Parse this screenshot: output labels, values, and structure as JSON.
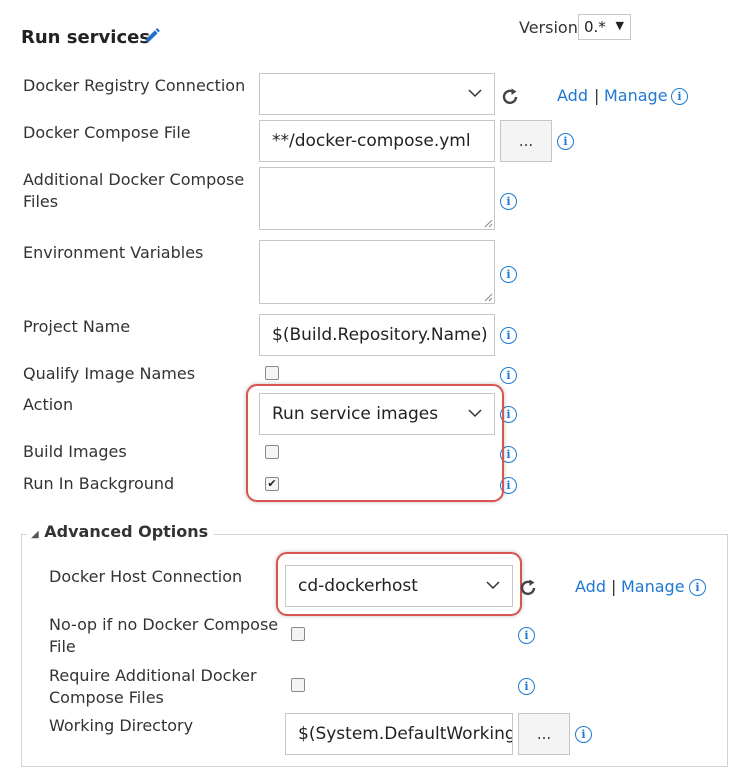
{
  "header": {
    "title": "Run services",
    "version_label": "Version",
    "version_value": "0.*"
  },
  "fields": {
    "registry": {
      "label": "Docker Registry Connection",
      "value": "",
      "add": "Add",
      "separator": "|",
      "manage": "Manage"
    },
    "compose_file": {
      "label": "Docker Compose File",
      "value": "**/docker-compose.yml",
      "browse": "..."
    },
    "additional_files": {
      "label_line1": "Additional Docker Compose",
      "label_line2": "Files",
      "value": ""
    },
    "env_vars": {
      "label": "Environment Variables",
      "value": ""
    },
    "project_name": {
      "label": "Project Name",
      "value": "$(Build.Repository.Name)"
    },
    "qualify": {
      "label": "Qualify Image Names",
      "checked": false
    },
    "action": {
      "label": "Action",
      "value": "Run service images"
    },
    "build_images": {
      "label": "Build Images",
      "checked": false
    },
    "run_background": {
      "label": "Run In Background",
      "checked": true
    }
  },
  "advanced": {
    "title": "Advanced Options",
    "host": {
      "label": "Docker Host Connection",
      "value": "cd-dockerhost",
      "add": "Add",
      "separator": "|",
      "manage": "Manage"
    },
    "noop": {
      "label_line1": "No-op if no Docker Compose",
      "label_line2": "File",
      "checked": false
    },
    "require": {
      "label_line1": "Require Additional Docker",
      "label_line2": "Compose Files",
      "checked": false
    },
    "workdir": {
      "label": "Working Directory",
      "value": "$(System.DefaultWorkingDirectory)",
      "browse": "..."
    }
  },
  "icons": {
    "info_glyph": "i",
    "check_glyph": "✔"
  },
  "colors": {
    "link": "#1f78d1",
    "highlight": "#d9534f",
    "info": "#1e7ad2"
  }
}
